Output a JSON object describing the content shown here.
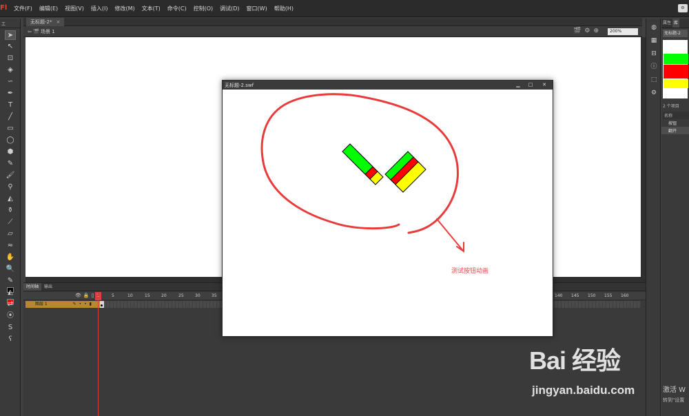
{
  "app": {
    "logo": "Fl"
  },
  "menu": [
    "文件(F)",
    "编辑(E)",
    "视图(V)",
    "插入(I)",
    "修改(M)",
    "文本(T)",
    "命令(C)",
    "控制(O)",
    "调试(D)",
    "窗口(W)",
    "帮助(H)"
  ],
  "toolbox": {
    "header": "工"
  },
  "document": {
    "tab_label": "无标题-2*",
    "tab_close": "×",
    "breadcrumb": "场景 1",
    "zoom": "200%"
  },
  "swf_window": {
    "title": "无标题-2.swf",
    "min": "▁",
    "max": "□",
    "close": "✕"
  },
  "annotation": {
    "text": "测试按钮动画",
    "color": "#e14a4a"
  },
  "timeline": {
    "tabs": [
      "时间轴",
      "输出"
    ],
    "frame_numbers": [
      "1",
      "5",
      "10",
      "15",
      "20",
      "25",
      "30",
      "35",
      "140",
      "145",
      "150",
      "155",
      "160",
      "1"
    ],
    "layer_name": "图层 1",
    "playhead_label": "1"
  },
  "library": {
    "tabs": [
      "属性",
      "库"
    ],
    "doc_select": "无标题-2",
    "item_count": "2 个项目",
    "col_name": "名称",
    "items": [
      "按钮",
      "翻开"
    ]
  },
  "watermark": {
    "logo": "Bai  经验",
    "url": "jingyan.baidu.com"
  },
  "os_notice": {
    "line1": "激活 W",
    "line2": "转到\"设置"
  },
  "colors": {
    "green": "#00ff00",
    "red": "#ff0000",
    "yellow": "#ffff00",
    "scribble": "#e83c3c"
  }
}
